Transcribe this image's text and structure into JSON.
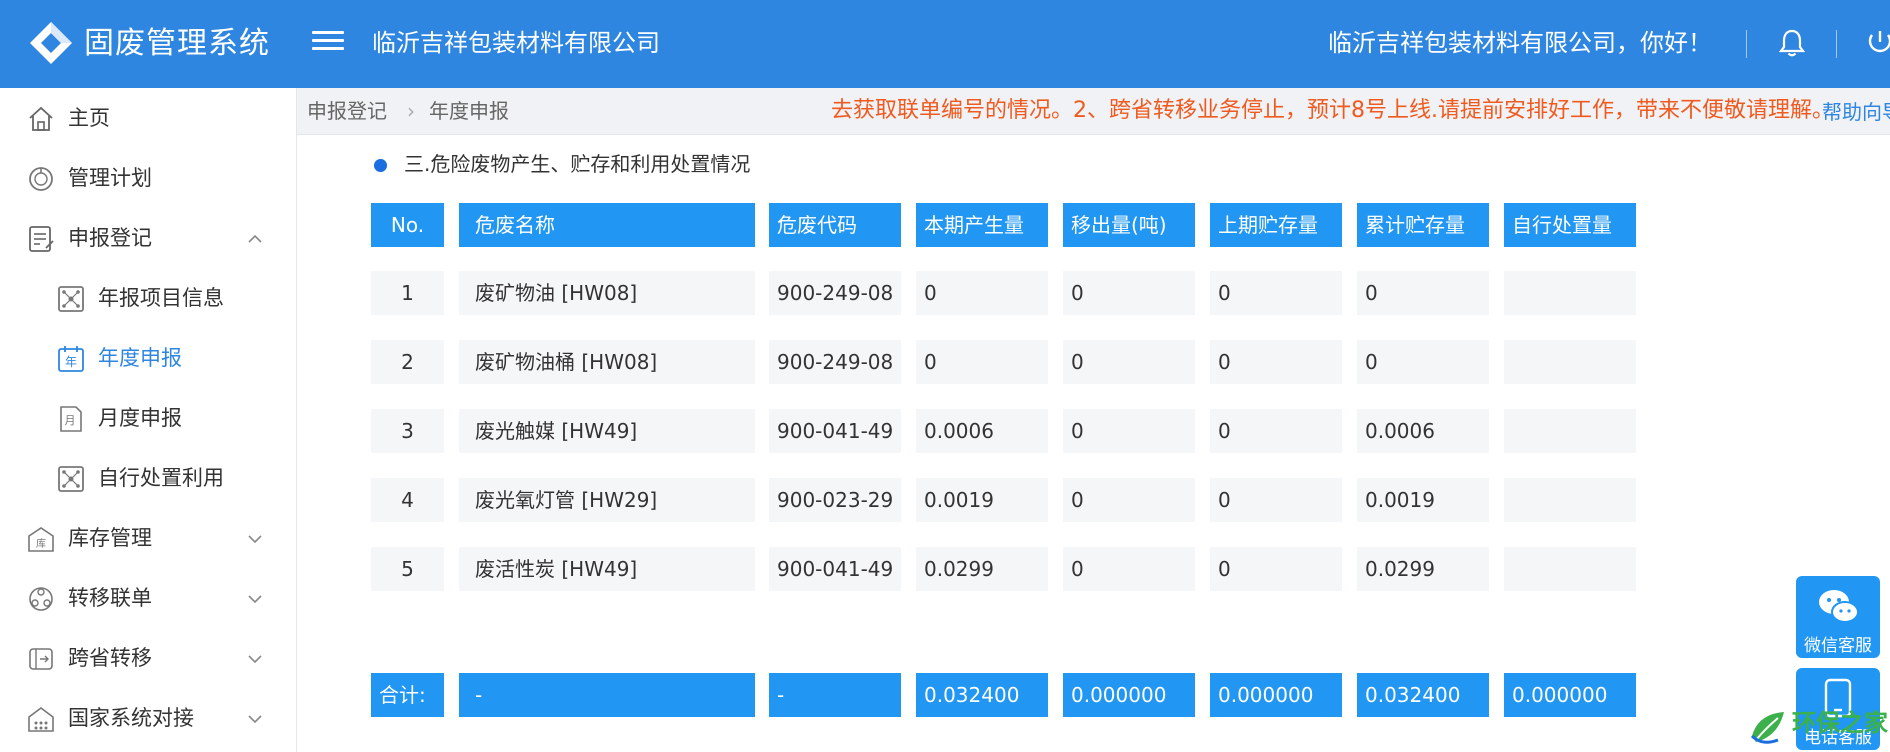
{
  "header": {
    "app_title": "固废管理系统",
    "company_name": "临沂吉祥包装材料有限公司",
    "greeting": "临沂吉祥包装材料有限公司，你好！"
  },
  "sidebar": {
    "items": [
      {
        "label": "主页",
        "icon": "home-icon"
      },
      {
        "label": "管理计划",
        "icon": "plan-icon"
      },
      {
        "label": "申报登记",
        "icon": "register-icon",
        "expanded": true
      },
      {
        "label": "年报项目信息",
        "icon": "project-info-icon"
      },
      {
        "label": "年度申报",
        "icon": "annual-icon",
        "active": true
      },
      {
        "label": "月度申报",
        "icon": "monthly-icon"
      },
      {
        "label": "自行处置利用",
        "icon": "disposal-icon"
      },
      {
        "label": "库存管理",
        "icon": "warehouse-icon"
      },
      {
        "label": "转移联单",
        "icon": "transfer-icon"
      },
      {
        "label": "跨省转移",
        "icon": "cross-province-icon"
      },
      {
        "label": "国家系统对接",
        "icon": "national-system-icon"
      }
    ]
  },
  "breadcrumb": {
    "items": [
      "申报登记",
      "年度申报"
    ],
    "separator": "›"
  },
  "notice": "去获取联单编号的情况。2、跨省转移业务停止，预计8号上线.请提前安排好工作，带来不便敬请理解。",
  "help_label": "帮助向导",
  "section": {
    "title": "三.危险废物产生、贮存和利用处置情况"
  },
  "table": {
    "headers": [
      "No.",
      "危废名称",
      "危废代码",
      "本期产生量",
      "移出量(吨)",
      "上期贮存量",
      "累计贮存量",
      "自行处置量"
    ],
    "rows": [
      [
        "1",
        "废矿物油 [HW08]",
        "900-249-08",
        "0",
        "0",
        "0",
        "0",
        ""
      ],
      [
        "2",
        "废矿物油桶 [HW08]",
        "900-249-08",
        "0",
        "0",
        "0",
        "0",
        ""
      ],
      [
        "3",
        "废光触媒 [HW49]",
        "900-041-49",
        "0.0006",
        "0",
        "0",
        "0.0006",
        ""
      ],
      [
        "4",
        "废光氧灯管 [HW29]",
        "900-023-29",
        "0.0019",
        "0",
        "0",
        "0.0019",
        ""
      ],
      [
        "5",
        "废活性炭 [HW49]",
        "900-041-49",
        "0.0299",
        "0",
        "0",
        "0.0299",
        ""
      ]
    ],
    "total": [
      "合计:",
      "-",
      "-",
      "0.032400",
      "0.000000",
      "0.000000",
      "0.032400",
      "0.000000"
    ]
  },
  "floating": {
    "wechat_label": "微信客服",
    "phone_label": "电话客服"
  },
  "watermark_text": "环保之家",
  "colors": {
    "header_bg": "#2f86e0",
    "table_header": "#2196f3",
    "active_nav": "#2f86e0",
    "notice_text": "#f05a1e",
    "row_bg": "#f5f6f8"
  }
}
